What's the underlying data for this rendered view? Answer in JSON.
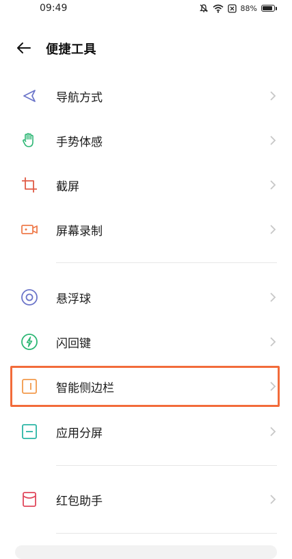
{
  "status_bar": {
    "time": "09:49",
    "battery": "88%",
    "icons": [
      "mute-icon",
      "wifi-icon",
      "close-box-icon",
      "battery-icon"
    ]
  },
  "header": {
    "title": "便捷工具",
    "back_icon": "arrow-left-icon"
  },
  "menu": {
    "group1": [
      {
        "label": "导航方式",
        "icon": "navigation-icon",
        "color": "#6b74c9"
      },
      {
        "label": "手势体感",
        "icon": "hand-gesture-icon",
        "color": "#2bb673"
      },
      {
        "label": "截屏",
        "icon": "crop-icon",
        "color": "#e05b45"
      },
      {
        "label": "屏幕录制",
        "icon": "video-record-icon",
        "color": "#ef7b4b"
      }
    ],
    "group2": [
      {
        "label": "悬浮球",
        "icon": "floating-ball-icon",
        "color": "#6b74c9"
      },
      {
        "label": "闪回键",
        "icon": "flash-icon",
        "color": "#2bb673"
      },
      {
        "label": "智能侧边栏",
        "icon": "sidebar-icon",
        "color": "#f29a4b"
      },
      {
        "label": "应用分屏",
        "icon": "split-screen-icon",
        "color": "#2ab5a5"
      }
    ],
    "group3": [
      {
        "label": "红包助手",
        "icon": "red-envelope-icon",
        "color": "#e0475b"
      }
    ]
  },
  "highlight_color": "#f26b3a"
}
